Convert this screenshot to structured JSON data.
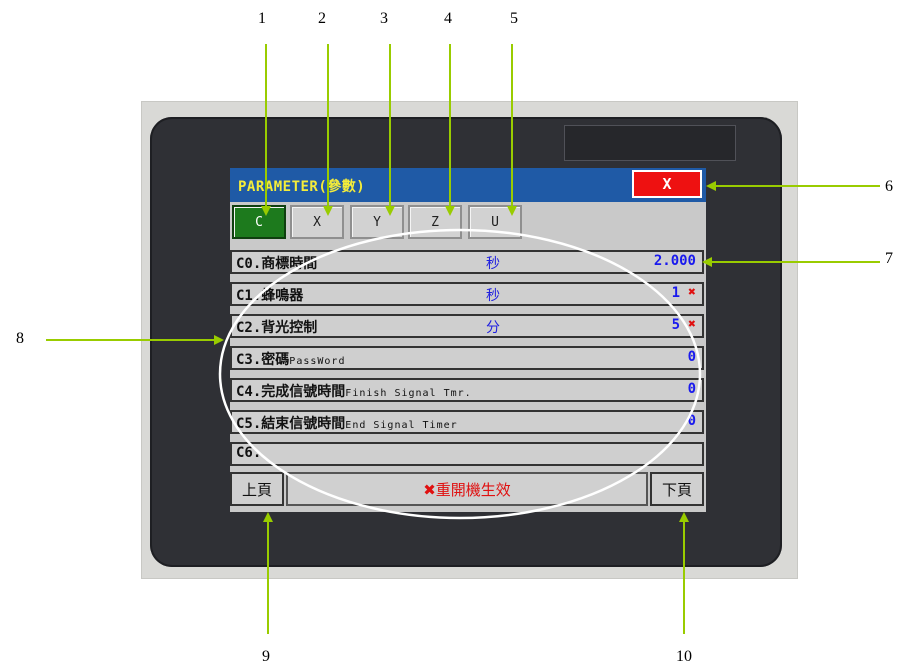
{
  "callouts": [
    "1",
    "2",
    "3",
    "4",
    "5",
    "6",
    "7",
    "8",
    "9",
    "10"
  ],
  "screen": {
    "title": "PARAMETER(參數)",
    "close_label": "X",
    "tabs": [
      "C",
      "X",
      "Y",
      "Z",
      "U"
    ],
    "active_tab": "C",
    "rows": [
      {
        "label": "C0.商標時間",
        "sub": "",
        "unit": "秒",
        "value": "2.000",
        "flag": ""
      },
      {
        "label": "C1.蜂鳴器",
        "sub": "",
        "unit": "秒",
        "value": "1",
        "flag": "✖"
      },
      {
        "label": "C2.背光控制",
        "sub": "",
        "unit": "分",
        "value": "5",
        "flag": "✖"
      },
      {
        "label": "C3.密碼",
        "sub": "PassWord",
        "unit": "",
        "value": "0",
        "flag": ""
      },
      {
        "label": "C4.完成信號時間",
        "sub": "Finish Signal Tmr.",
        "unit": "",
        "value": "0",
        "flag": ""
      },
      {
        "label": "C5.結束信號時間",
        "sub": "End Signal Timer",
        "unit": "",
        "value": "0",
        "flag": ""
      },
      {
        "label": "C6.",
        "sub": "",
        "unit": "",
        "value": "",
        "flag": ""
      }
    ],
    "prev_label": "上頁",
    "next_label": "下頁",
    "notice": "✖重開機生效"
  },
  "colors": {
    "title_bg": "#1f5aa6",
    "title_text": "#f4ec3a",
    "close_bg": "#ee1111",
    "active_tab": "#1d7a1d",
    "value_blue": "#1a1aee",
    "flag_red": "#e01010",
    "arrow_green": "#99cc00"
  }
}
